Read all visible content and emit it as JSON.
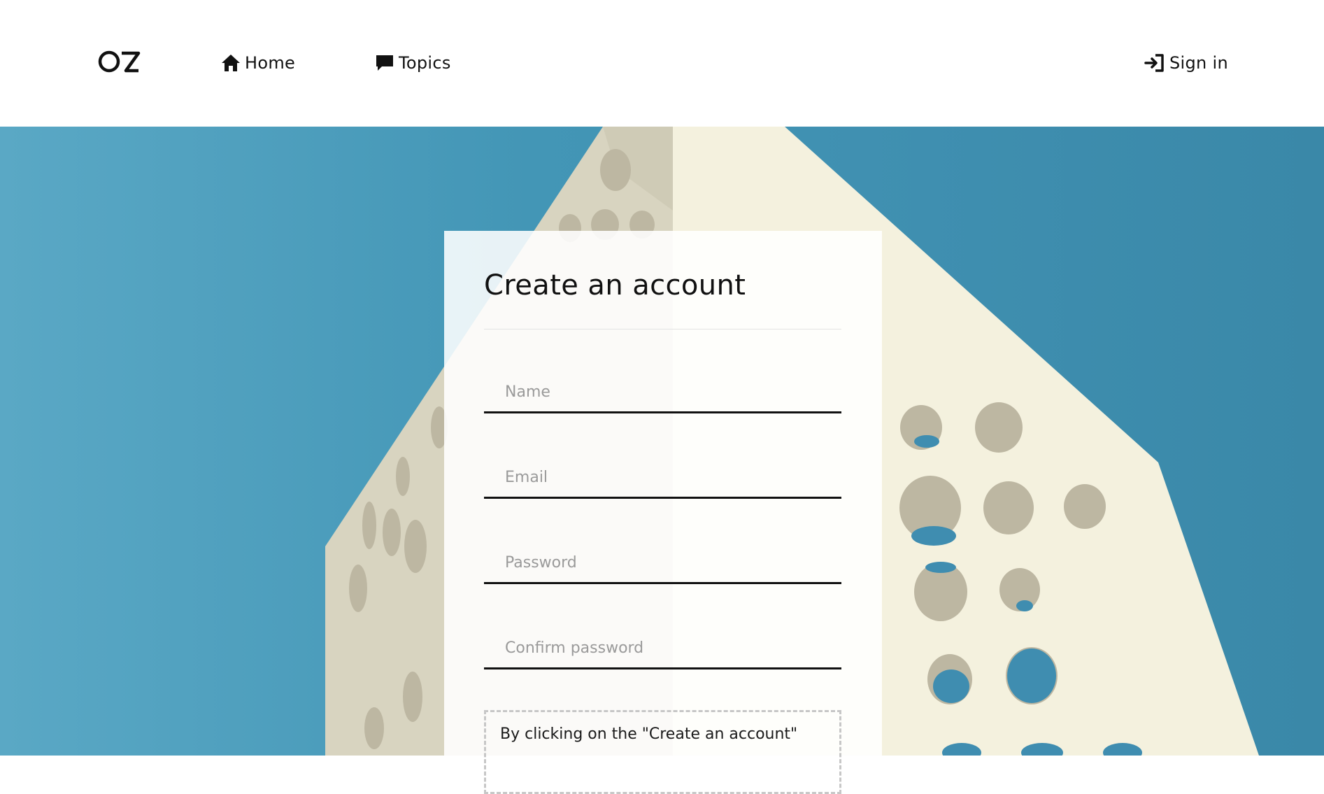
{
  "header": {
    "logo_text": "OZ",
    "nav": {
      "home_label": "Home",
      "topics_label": "Topics",
      "signin_label": "Sign in"
    }
  },
  "signup": {
    "title": "Create an account",
    "fields": {
      "name_placeholder": "Name",
      "email_placeholder": "Email",
      "password_placeholder": "Password",
      "confirm_password_placeholder": "Confirm password"
    },
    "terms_text": "By clicking on the \"Create an account\""
  },
  "colors": {
    "sky": "#4396b6",
    "building": "#f4f1de",
    "text": "#111111",
    "placeholder": "#9a9a9a"
  }
}
